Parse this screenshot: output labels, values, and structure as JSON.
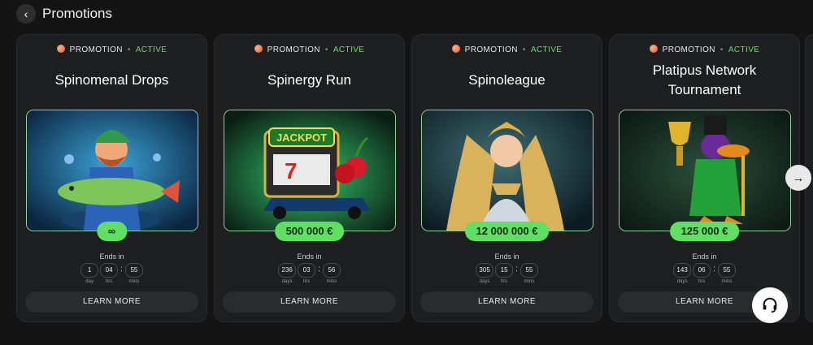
{
  "header": {
    "title": "Promotions",
    "back_icon": "chevron-left-icon"
  },
  "cards": [
    {
      "type_label": "PROMOTION",
      "status": "ACTIVE",
      "title": "Spinomenal Drops",
      "prize": "∞",
      "ends_label": "Ends in",
      "timer": {
        "days": "1",
        "hrs": "04",
        "mins": "55"
      },
      "timer_labels": {
        "days": "day",
        "hrs": "hrs",
        "mins": "mins"
      },
      "cta": "LEARN MORE"
    },
    {
      "type_label": "PROMOTION",
      "status": "ACTIVE",
      "title": "Spinergy Run",
      "prize": "500 000 €",
      "ends_label": "Ends in",
      "timer": {
        "days": "236",
        "hrs": "03",
        "mins": "56"
      },
      "timer_labels": {
        "days": "days",
        "hrs": "hrs",
        "mins": "mins"
      },
      "cta": "LEARN MORE"
    },
    {
      "type_label": "PROMOTION",
      "status": "ACTIVE",
      "title": "Spinoleague",
      "prize": "12 000 000 €",
      "ends_label": "Ends in",
      "timer": {
        "days": "305",
        "hrs": "15",
        "mins": "55"
      },
      "timer_labels": {
        "days": "days",
        "hrs": "hrs",
        "mins": "mins"
      },
      "cta": "LEARN MORE"
    },
    {
      "type_label": "PROMOTION",
      "status": "ACTIVE",
      "title": "Platipus Network Tournament",
      "prize": "125 000 €",
      "ends_label": "Ends in",
      "timer": {
        "days": "143",
        "hrs": "06",
        "mins": "55"
      },
      "timer_labels": {
        "days": "days",
        "hrs": "hrs",
        "mins": "mins"
      },
      "cta": "LEARN MORE"
    }
  ],
  "art_text": {
    "jackpot": "JACKPOT"
  },
  "colors": {
    "accent": "#5fe063",
    "status": "#5fe06a",
    "card_bg": "#1d1e1f",
    "page_bg": "#141414"
  },
  "icons": {
    "next": "arrow-right-icon",
    "support": "headset-icon",
    "promo": "promotion-icon"
  }
}
